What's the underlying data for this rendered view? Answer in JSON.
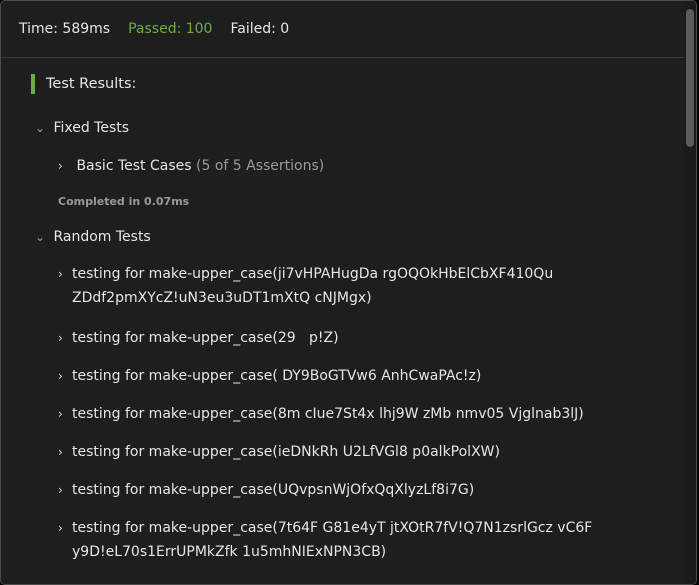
{
  "header": {
    "time": "Time: 589ms",
    "passed": "Passed: 100",
    "failed": "Failed: 0"
  },
  "results_title": "Test Results:",
  "fixed": {
    "label": "Fixed Tests",
    "group_label": "Basic Test Cases",
    "group_count": "(5 of 5 Assertions)",
    "completed": "Completed in 0.07ms"
  },
  "random": {
    "label": "Random Tests",
    "items": [
      {
        "line1": "testing for make-upper_case(ji7vHPAHugDa rgOQOkHbElCbXF410Qu",
        "line2": "ZDdf2pmXYcZ!uN3eu3uDT1mXtQ cNJMgx)"
      },
      {
        "line1": "testing for make-upper_case(29   p!Z)"
      },
      {
        "line1": "testing for make-upper_case( DY9BoGTVw6 AnhCwaPAc!z)"
      },
      {
        "line1": "testing for make-upper_case(8m cIue7St4x lhj9W zMb nmv05 Vjglnab3lJ)"
      },
      {
        "line1": "testing for make-upper_case(ieDNkRh U2LfVGl8 p0alkPolXW)"
      },
      {
        "line1": "testing for make-upper_case(UQvpsnWjOfxQqXlyzLf8i7G)"
      },
      {
        "line1": "testing for make-upper_case(7t64F G81e4yT jtXOtR7fV!Q7N1zsrlGcz vC6F",
        "line2": "y9D!eL70s1ErrUPMkZfk 1u5mhNIExNPN3CB)"
      }
    ]
  },
  "colors": {
    "accent_green": "#6cae3f",
    "background": "#1e1e1e"
  },
  "icons": {
    "collapsed": "chevron-right-icon",
    "expanded": "chevron-down-icon"
  }
}
